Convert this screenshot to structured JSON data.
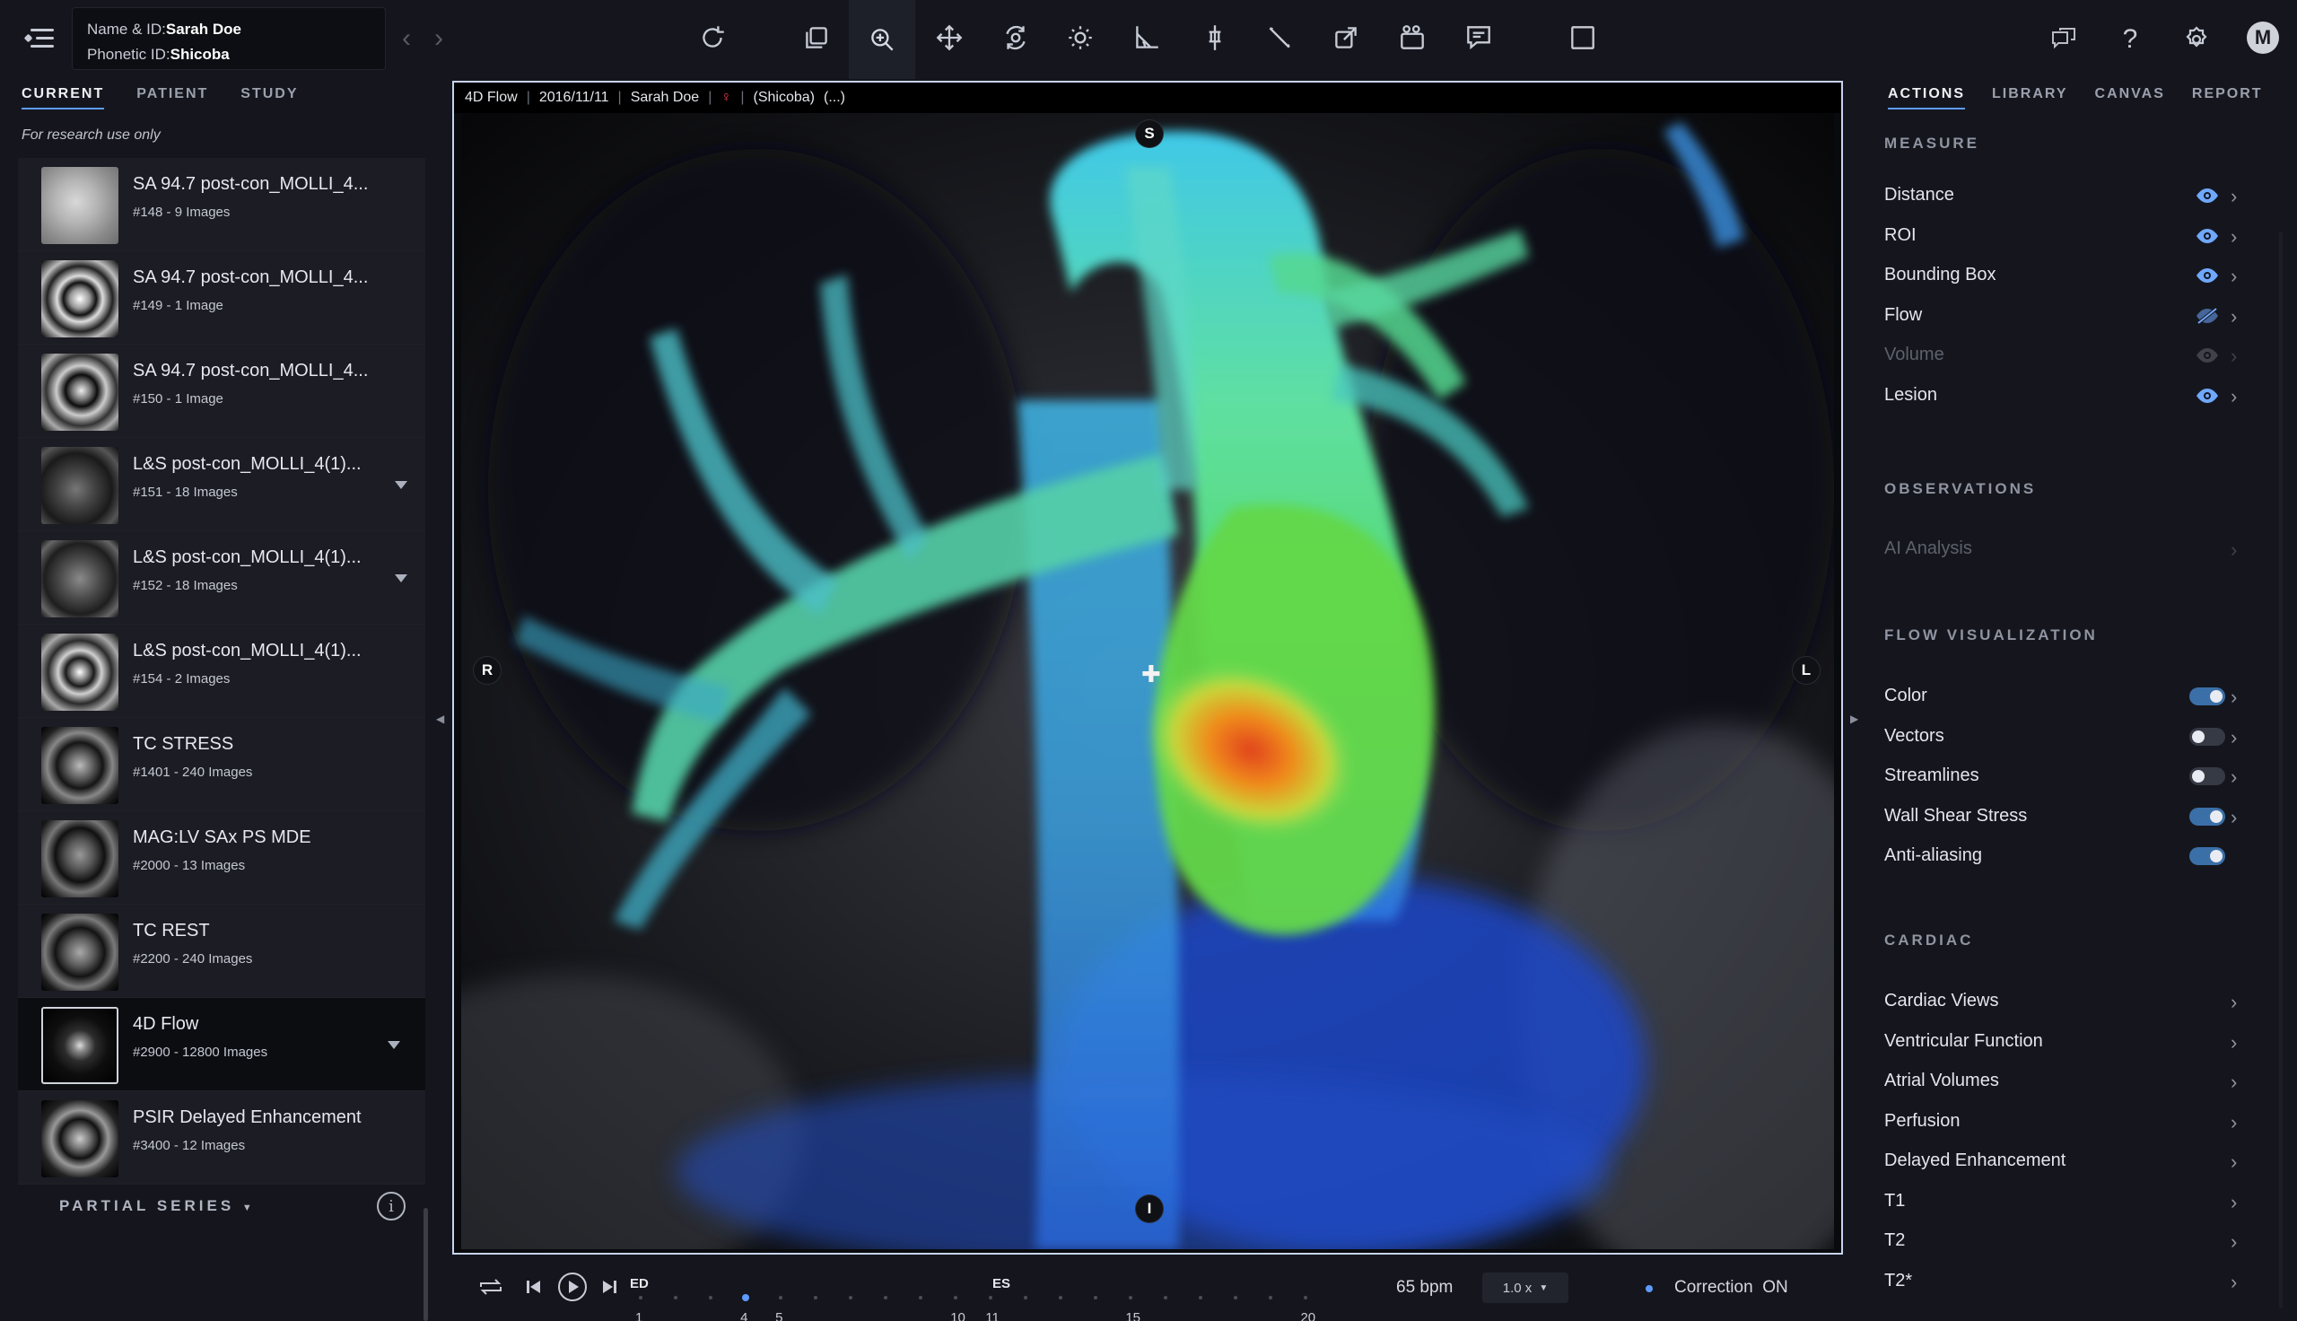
{
  "patient": {
    "name_label": "Name & ID:",
    "name": "Sarah Doe",
    "phonetic_label": "Phonetic ID:",
    "phonetic": "Shicoba"
  },
  "left_tabs": [
    "CURRENT",
    "PATIENT",
    "STUDY"
  ],
  "research_note": "For research use only",
  "series": [
    {
      "title": "SA 94.7 post-con_MOLLI_4...",
      "sub": "#148 - 9 Images",
      "caret": false
    },
    {
      "title": "SA 94.7 post-con_MOLLI_4...",
      "sub": "#149 - 1 Image",
      "caret": false
    },
    {
      "title": "SA 94.7 post-con_MOLLI_4...",
      "sub": "#150 - 1 Image",
      "caret": false
    },
    {
      "title": "L&S post-con_MOLLI_4(1)...",
      "sub": "#151 - 18 Images",
      "caret": true
    },
    {
      "title": "L&S post-con_MOLLI_4(1)...",
      "sub": "#152 - 18 Images",
      "caret": true
    },
    {
      "title": "L&S post-con_MOLLI_4(1)...",
      "sub": "#154 - 2 Images",
      "caret": false
    },
    {
      "title": "TC STRESS",
      "sub": "#1401 - 240 Images",
      "caret": false
    },
    {
      "title": "MAG:LV SAx PS MDE",
      "sub": "#2000 - 13 Images",
      "caret": false
    },
    {
      "title": "TC REST",
      "sub": "#2200 - 240 Images",
      "caret": false
    },
    {
      "title": "4D Flow",
      "sub": "#2900 - 12800 Images",
      "caret": true
    },
    {
      "title": "PSIR Delayed Enhancement",
      "sub": "#3400 - 12 Images",
      "caret": false
    }
  ],
  "partial_series": "PARTIAL SERIES",
  "viewport": {
    "series": "4D Flow",
    "date": "2016/11/11",
    "patient": "Sarah Doe",
    "phonetic": "(Shicoba)",
    "more": "(...)",
    "orient": {
      "top": "S",
      "bottom": "I",
      "left": "R",
      "right": "L"
    }
  },
  "playback": {
    "marks": {
      "ed": "ED",
      "es": "ES"
    },
    "frames": [
      "1",
      "4",
      "5",
      "10",
      "11",
      "15",
      "20"
    ],
    "current_frame": 4,
    "total_frames": 20,
    "bpm": "65 bpm",
    "speed": "1.0 x",
    "correction": "Correction  ON"
  },
  "right_tabs": [
    "ACTIONS",
    "LIBRARY",
    "CANVAS",
    "REPORT"
  ],
  "sections": {
    "measure": "MEASURE",
    "observations": "OBSERVATIONS",
    "flow_vis": "FLOW VISUALIZATION",
    "cardiac": "CARDIAC"
  },
  "measure_items": [
    {
      "label": "Distance",
      "eye": "visible"
    },
    {
      "label": "ROI",
      "eye": "visible"
    },
    {
      "label": "Bounding Box",
      "eye": "visible"
    },
    {
      "label": "Flow",
      "eye": "hidden"
    },
    {
      "label": "Volume",
      "eye": "disabled"
    },
    {
      "label": "Lesion",
      "eye": "visible"
    }
  ],
  "observation_items": [
    {
      "label": "AI Analysis"
    }
  ],
  "flow_items": [
    {
      "label": "Color",
      "on": true
    },
    {
      "label": "Vectors",
      "on": false
    },
    {
      "label": "Streamlines",
      "on": false
    },
    {
      "label": "Wall Shear Stress",
      "on": true
    },
    {
      "label": "Anti-aliasing",
      "on": true
    }
  ],
  "cardiac_items": [
    "Cardiac Views",
    "Ventricular Function",
    "Atrial Volumes",
    "Perfusion",
    "Delayed Enhancement",
    "T1",
    "T2",
    "T2*"
  ],
  "colors": {
    "accent": "#5e9bff",
    "bg": "#15161d",
    "panel": "#1b1c24"
  },
  "icons": [
    "hamburger-icon",
    "reset-icon",
    "layers-icon",
    "zoom-icon",
    "pan-icon",
    "rotate-icon",
    "brightness-icon",
    "angle-icon",
    "probe-icon",
    "ruler-icon",
    "share-icon",
    "camera-icon",
    "comment-icon",
    "layout-icon",
    "chat-icon",
    "help-icon",
    "settings-icon"
  ]
}
